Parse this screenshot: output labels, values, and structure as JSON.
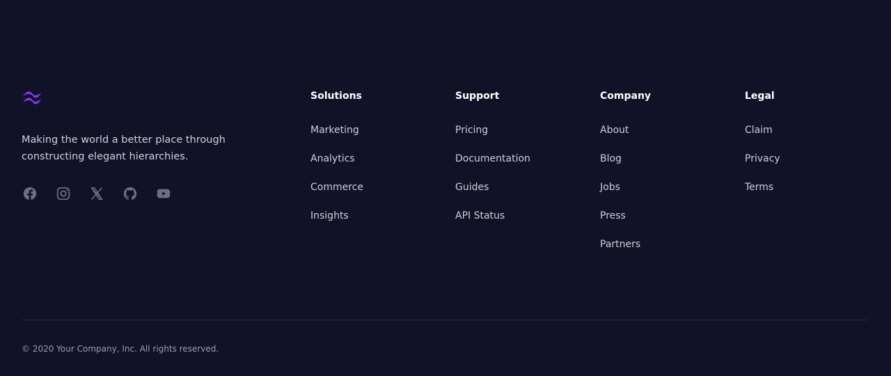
{
  "brand": {
    "logo_icon": "tailwind-wave-icon",
    "accent_color": "#7c3aed",
    "tagline": "Making the world a better place through constructing elegant hierarchies."
  },
  "socials": [
    {
      "icon": "facebook-icon"
    },
    {
      "icon": "instagram-icon"
    },
    {
      "icon": "x-icon"
    },
    {
      "icon": "github-icon"
    },
    {
      "icon": "youtube-icon"
    }
  ],
  "columns": {
    "solutions": {
      "title": "Solutions",
      "links": [
        "Marketing",
        "Analytics",
        "Commerce",
        "Insights"
      ]
    },
    "support": {
      "title": "Support",
      "links": [
        "Pricing",
        "Documentation",
        "Guides",
        "API Status"
      ]
    },
    "company": {
      "title": "Company",
      "links": [
        "About",
        "Blog",
        "Jobs",
        "Press",
        "Partners"
      ]
    },
    "legal": {
      "title": "Legal",
      "links": [
        "Claim",
        "Privacy",
        "Terms"
      ]
    }
  },
  "copyright": "© 2020 Your Company, Inc. All rights reserved."
}
